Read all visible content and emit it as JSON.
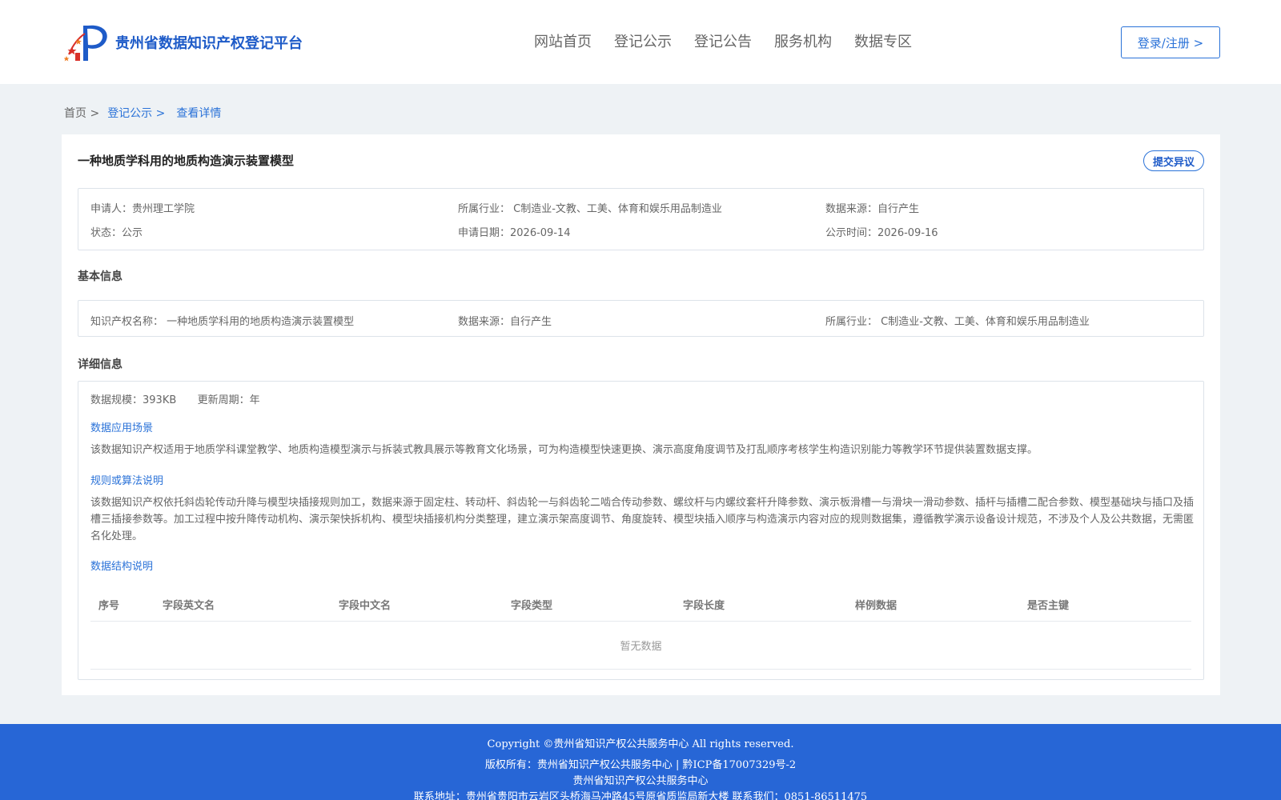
{
  "header": {
    "logo_text": "贵州省数据知识产权登记平台",
    "nav": [
      "网站首页",
      "登记公示",
      "登记公告",
      "服务机构",
      "数据专区"
    ],
    "login_label": "登录/注册 >"
  },
  "breadcrumb": {
    "home": "首页 >",
    "section": "登记公示 >",
    "current": "查看详情"
  },
  "record": {
    "title": "一种地质学科用的地质构造演示装置模型",
    "objection_label": "提交异议",
    "summary": {
      "applicant_label": "申请人：",
      "applicant": "贵州理工学院",
      "industry_label": "所属行业：",
      "industry": "C制造业-文教、工美、体育和娱乐用品制造业",
      "source_label": "数据来源：",
      "source": "自行产生",
      "status_label": "状态：",
      "status": "公示",
      "apply_date_label": "申请日期：",
      "apply_date": "2026-09-14",
      "publish_time_label": "公示时间：",
      "publish_time": "2026-09-16"
    },
    "basic": {
      "section_title": "基本信息",
      "ip_name_label": "知识产权名称：",
      "ip_name": "一种地质学科用的地质构造演示装置模型",
      "source_label": "数据来源：",
      "source": "自行产生",
      "industry_label": "所属行业：",
      "industry": "C制造业-文教、工美、体育和娱乐用品制造业"
    },
    "detail": {
      "section_title": "详细信息",
      "scale_label": "数据规模：",
      "scale": "393KB",
      "cycle_label": "更新周期：",
      "cycle": "年",
      "scenario_title": "数据应用场景",
      "scenario_text": "该数据知识产权适用于地质学科课堂教学、地质构造模型演示与拆装式教具展示等教育文化场景，可为构造模型快速更换、演示高度角度调节及打乱顺序考核学生构造识别能力等教学环节提供装置数据支撑。",
      "rules_title": "规则或算法说明",
      "rules_text": "该数据知识产权依托斜齿轮传动升降与模型块插接规则加工，数据来源于固定柱、转动杆、斜齿轮一与斜齿轮二啮合传动参数、螺纹杆与内螺纹套杆升降参数、演示板滑槽一与滑块一滑动参数、插杆与插槽二配合参数、模型基础块与插口及插槽三插接参数等。加工过程中按升降传动机构、演示架快拆机构、模型块插接机构分类整理，建立演示架高度调节、角度旋转、模型块插入顺序与构造演示内容对应的规则数据集，遵循教学演示设备设计规范，不涉及个人及公共数据，无需匿名化处理。",
      "structure_title": "数据结构说明",
      "columns": [
        "序号",
        "字段英文名",
        "字段中文名",
        "字段类型",
        "字段长度",
        "样例数据",
        "是否主键"
      ],
      "empty_text": "暂无数据"
    }
  },
  "footer": {
    "copyright": "Copyright ©贵州省知识产权公共服务中心 All rights reserved.",
    "owner": "版权所有：贵州省知识产权公共服务中心 | 黔ICP备17007329号-2",
    "org": "贵州省知识产权公共服务中心",
    "address": "联系地址：贵州省贵阳市云岩区头桥海马冲路45号原省质监局新大楼 联系我们：0851-86511475"
  },
  "colors": {
    "brand_blue": "#1e5bc8",
    "link_blue": "#2a72d8",
    "footer_blue": "#2766d6",
    "page_bg": "#eef2f5",
    "logo_red": "#d9302a",
    "logo_orange": "#ef7d22"
  }
}
